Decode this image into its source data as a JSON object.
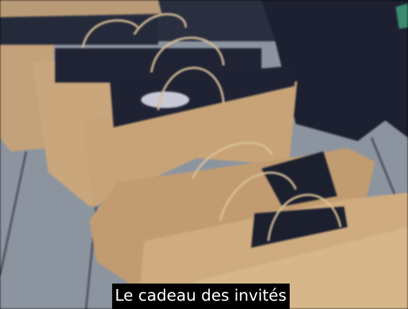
{
  "caption": "Le cadeau des invités",
  "colors": {
    "bag": "#c7a377",
    "floor": "#8c94a0",
    "box": "#1e2233",
    "caption_bg": "#000000",
    "caption_text": "#ffffff"
  }
}
